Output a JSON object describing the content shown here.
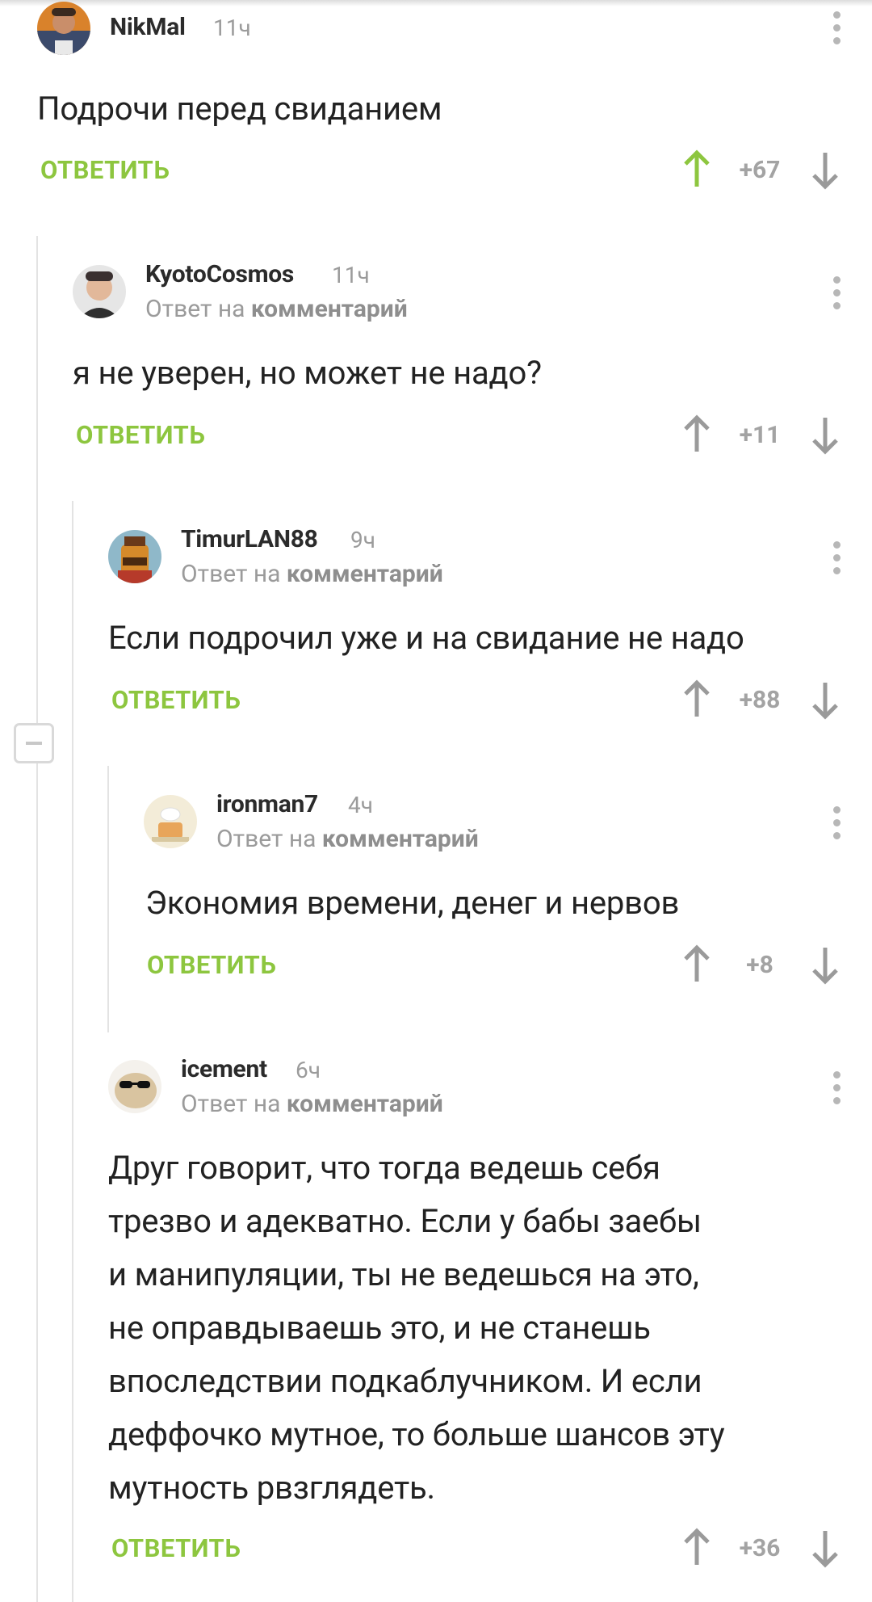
{
  "reply_label": "ОТВЕТИТЬ",
  "reply_to_prefix": "Ответ на",
  "reply_to_link": "комментарий",
  "colors": {
    "accent_green": "#8dc63f",
    "muted_gray": "#9b9b9b"
  },
  "comments": [
    {
      "author": "NikMal",
      "time": "11ч",
      "text": "Подрочи перед свиданием",
      "score": "+67",
      "upvoted": true
    },
    {
      "author": "KyotoCosmos",
      "time": "11ч",
      "text": "я не уверен, но может не надо?",
      "score": "+11",
      "upvoted": false
    },
    {
      "author": "TimurLAN88",
      "time": "9ч",
      "text": "Если подрочил уже и на свидание не надо",
      "score": "+88",
      "upvoted": false
    },
    {
      "author": "ironman7",
      "time": "4ч",
      "text": "Экономия времени, денег и нервов",
      "score": "+8",
      "upvoted": false
    },
    {
      "author": "icement",
      "time": "6ч",
      "text_lines": [
        "Друг говорит, что тогда ведешь себя",
        "трезво и адекватно. Если у бабы заебы",
        "и манипуляции, ты не ведешься на это,",
        "не оправдываешь это, и не станешь",
        "впоследствии подкаблучником. И если",
        "деффочко мутное, то больше шансов эту",
        "мутность рвзглядеть."
      ],
      "score": "+36",
      "upvoted": false
    }
  ]
}
